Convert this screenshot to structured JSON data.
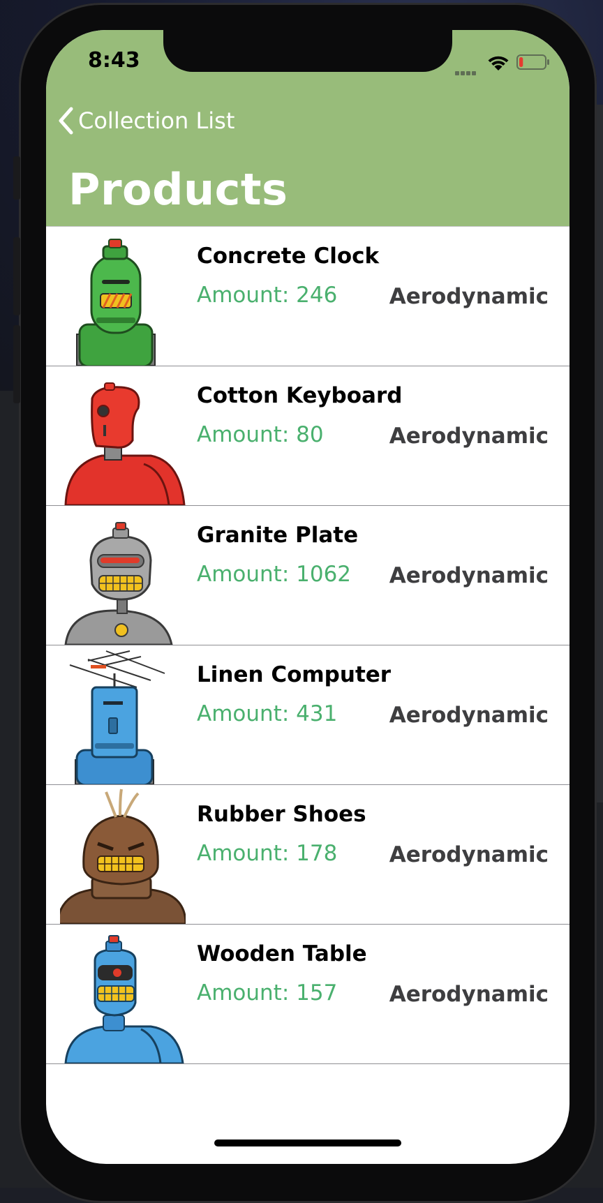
{
  "status_bar": {
    "time": "8:43",
    "wifi_icon": "wifi-icon",
    "battery_icon": "battery-low-icon",
    "battery_level": 0.15
  },
  "nav": {
    "back_label": "Collection List",
    "title": "Products"
  },
  "colors": {
    "header": "#98bc7a",
    "amount": "#4ab06e",
    "category": "#3e3e40"
  },
  "products": [
    {
      "name": "Concrete Clock",
      "amount": "Amount: 246",
      "category": "Aerodynamic",
      "image": "green-robot"
    },
    {
      "name": "Cotton Keyboard",
      "amount": "Amount: 80",
      "category": "Aerodynamic",
      "image": "red-robot"
    },
    {
      "name": "Granite Plate",
      "amount": "Amount: 1062",
      "category": "Aerodynamic",
      "image": "gray-robot"
    },
    {
      "name": "Linen Computer",
      "amount": "Amount: 431",
      "category": "Aerodynamic",
      "image": "blue-antenna-robot"
    },
    {
      "name": "Rubber Shoes",
      "amount": "Amount: 178",
      "category": "Aerodynamic",
      "image": "brown-robot"
    },
    {
      "name": "Wooden Table",
      "amount": "Amount: 157",
      "category": "Aerodynamic",
      "image": "blue-robot"
    }
  ]
}
